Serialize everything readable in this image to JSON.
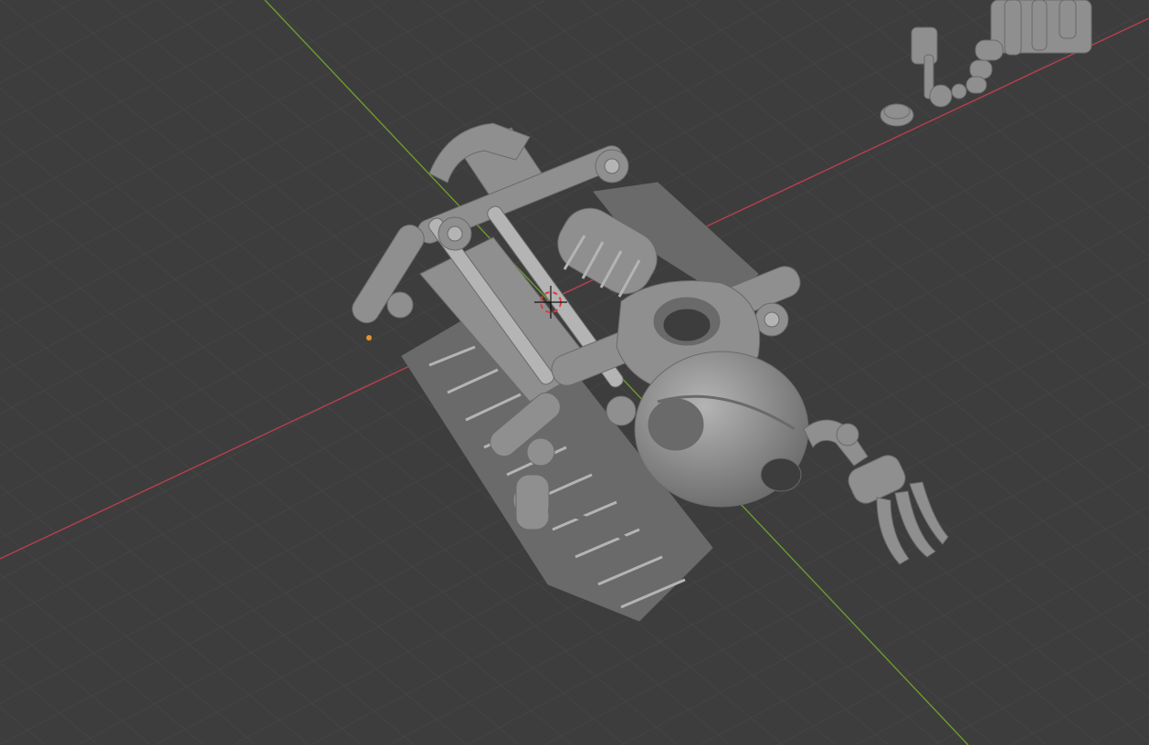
{
  "viewport": {
    "background_color": "#3d3d3d",
    "grid_color": "#4a4a4a",
    "x_axis_color": "#b8404d",
    "y_axis_color": "#6f9a2e",
    "model_color": "#8f8f8f",
    "model_shadow_color": "#6a6a6a",
    "model_highlight_color": "#b4b4b4",
    "cursor_color": "#e23a3a",
    "origin_dot_color": "#e8922a",
    "shading_mode": "solid"
  },
  "scene": {
    "main_object": "crawler-robot-mesh",
    "secondary_objects": [
      "robot-parts-cluster",
      "disc-part"
    ],
    "icons": [
      "3d-cursor-icon",
      "object-origin-icon"
    ]
  }
}
